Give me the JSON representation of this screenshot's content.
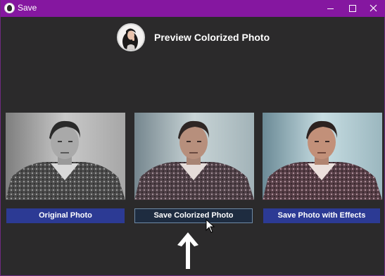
{
  "window": {
    "title": "Save",
    "titlebar_color": "#8517a0",
    "background_color": "#2b2a2b"
  },
  "header": {
    "title": "Preview Colorized Photo",
    "avatar_icon": "woman-portrait-avatar"
  },
  "photos": [
    {
      "name": "original-photo",
      "style": "grayscale"
    },
    {
      "name": "colorized-photo",
      "style": "color"
    },
    {
      "name": "effects-photo",
      "style": "color-with-effects"
    }
  ],
  "buttons": {
    "original": "Original Photo",
    "save_colorized": "Save Colorized Photo",
    "save_effects": "Save Photo with Effects"
  },
  "colors": {
    "button_blue": "#2c3a94",
    "button_hover": "#1e2c40"
  }
}
